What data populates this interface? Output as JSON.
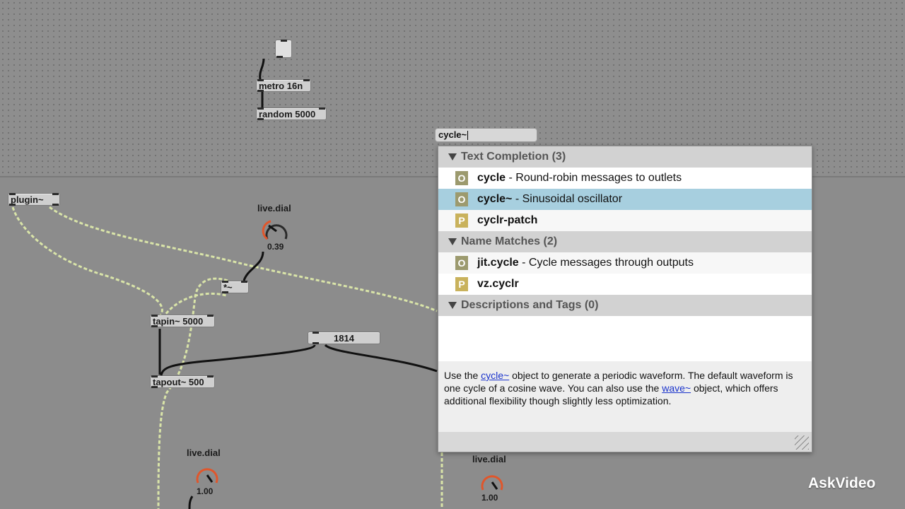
{
  "canvas": {
    "objects": {
      "metro": "metro 16n",
      "random": "random 5000",
      "plugin": "plugin~",
      "mult": "*~",
      "tapin": "tapin~ 5000",
      "tapout": "tapout~ 500",
      "number": "1814"
    },
    "dials": [
      {
        "label": "live.dial",
        "value": "0.39"
      },
      {
        "label": "live.dial",
        "value": "1.00"
      },
      {
        "label": "live.dial",
        "value": "1.00"
      }
    ]
  },
  "new_object": {
    "value": "cycle~"
  },
  "popup": {
    "sections": [
      {
        "label": "Text Completion (3)"
      },
      {
        "label": "Name Matches (2)"
      },
      {
        "label": "Descriptions and Tags (0)"
      }
    ],
    "text_completion": [
      {
        "badge": "O",
        "name": "cycle",
        "desc": " - Round-robin messages to outlets"
      },
      {
        "badge": "O",
        "name": "cycle~",
        "desc": " - Sinusoidal oscillator"
      },
      {
        "badge": "P",
        "name": "cyclr-patch",
        "desc": ""
      }
    ],
    "name_matches": [
      {
        "badge": "O",
        "name": "jit.cycle",
        "desc": " - Cycle messages through outputs"
      },
      {
        "badge": "P",
        "name": "vz.cyclr",
        "desc": ""
      }
    ],
    "description": {
      "part1": "Use the ",
      "link1": "cycle~",
      "part2": " object to generate a periodic waveform. The default waveform is one cycle of a cosine wave. You can also use the ",
      "link2": "wave~",
      "part3": " object, which offers additional flexibility though slightly less optimization."
    }
  },
  "brand": "AskVideo"
}
